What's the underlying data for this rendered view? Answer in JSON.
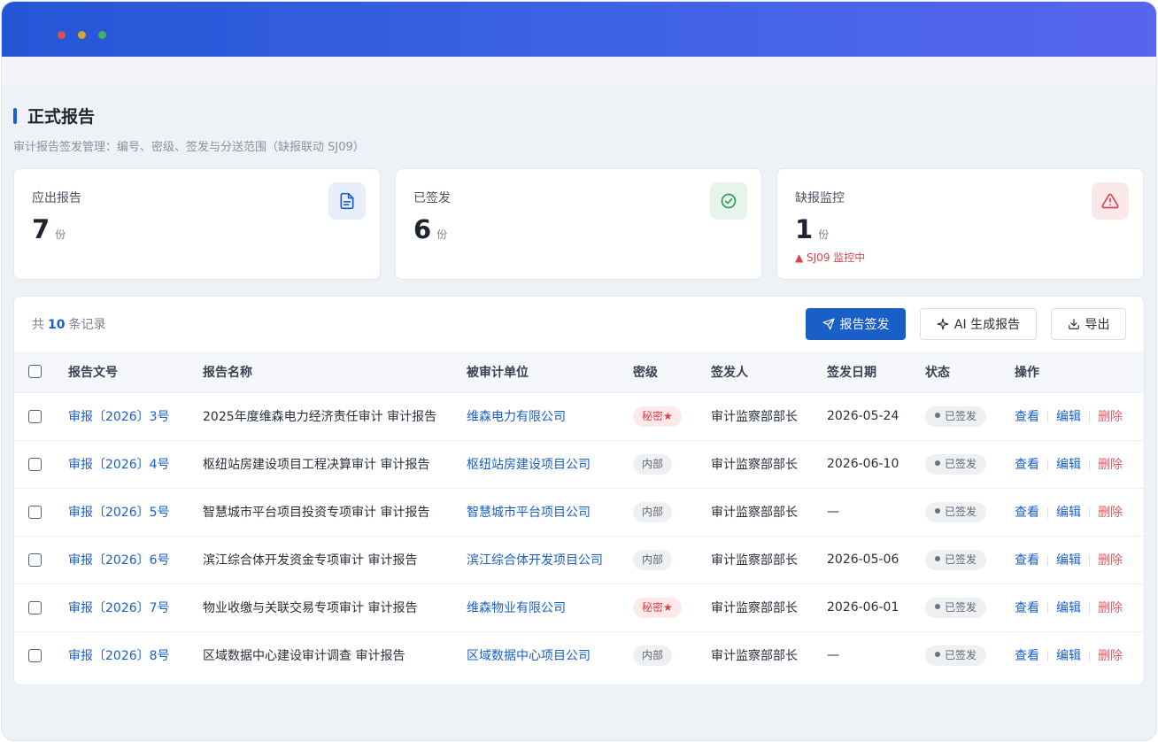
{
  "window": {
    "controls": [
      "close",
      "minimize",
      "maximize"
    ]
  },
  "page": {
    "title": "正式报告",
    "subtitle": "审计报告签发管理：编号、密级、签发与分送范围（缺报联动 SJ09）"
  },
  "stats": [
    {
      "label": "应出报告",
      "value": "7",
      "unit": "份",
      "note": "",
      "icon": "document-icon"
    },
    {
      "label": "已签发",
      "value": "6",
      "unit": "份",
      "note": "",
      "icon": "check-circle-icon"
    },
    {
      "label": "缺报监控",
      "value": "1",
      "unit": "份",
      "note": "▲ SJ09 监控中",
      "icon": "warning-icon"
    }
  ],
  "toolbar": {
    "count_prefix": "共",
    "count": "10",
    "count_suffix": "条记录",
    "issue_label": "报告签发",
    "ai_label": "AI 生成报告",
    "export_label": "导出"
  },
  "table": {
    "headers": {
      "number": "报告文号",
      "name": "报告名称",
      "unit": "被审计单位",
      "secret": "密级",
      "signer": "签发人",
      "date": "签发日期",
      "status": "状态",
      "ops": "操作"
    },
    "rows": [
      {
        "number": "审报〔2026〕3号",
        "name": "2025年度维森电力经济责任审计 审计报告",
        "unit": "维森电力有限公司",
        "secret": "秘密★",
        "secret_type": "secret",
        "signer": "审计监察部部长",
        "date": "2026-05-24",
        "status": "已签发"
      },
      {
        "number": "审报〔2026〕4号",
        "name": "枢纽站房建设项目工程决算审计 审计报告",
        "unit": "枢纽站房建设项目公司",
        "secret": "内部",
        "secret_type": "internal",
        "signer": "审计监察部部长",
        "date": "2026-06-10",
        "status": "已签发"
      },
      {
        "number": "审报〔2026〕5号",
        "name": "智慧城市平台项目投资专项审计 审计报告",
        "unit": "智慧城市平台项目公司",
        "secret": "内部",
        "secret_type": "internal",
        "signer": "审计监察部部长",
        "date": "—",
        "status": "已签发"
      },
      {
        "number": "审报〔2026〕6号",
        "name": "滨江综合体开发资金专项审计 审计报告",
        "unit": "滨江综合体开发项目公司",
        "secret": "内部",
        "secret_type": "internal",
        "signer": "审计监察部部长",
        "date": "2026-05-06",
        "status": "已签发"
      },
      {
        "number": "审报〔2026〕7号",
        "name": "物业收缴与关联交易专项审计 审计报告",
        "unit": "维森物业有限公司",
        "secret": "秘密★",
        "secret_type": "secret",
        "signer": "审计监察部部长",
        "date": "2026-06-01",
        "status": "已签发"
      },
      {
        "number": "审报〔2026〕8号",
        "name": "区域数据中心建设审计调查 审计报告",
        "unit": "区域数据中心项目公司",
        "secret": "内部",
        "secret_type": "internal",
        "signer": "审计监察部部长",
        "date": "—",
        "status": "已签发"
      }
    ],
    "ops": {
      "view": "查看",
      "edit": "编辑",
      "delete": "删除"
    }
  }
}
